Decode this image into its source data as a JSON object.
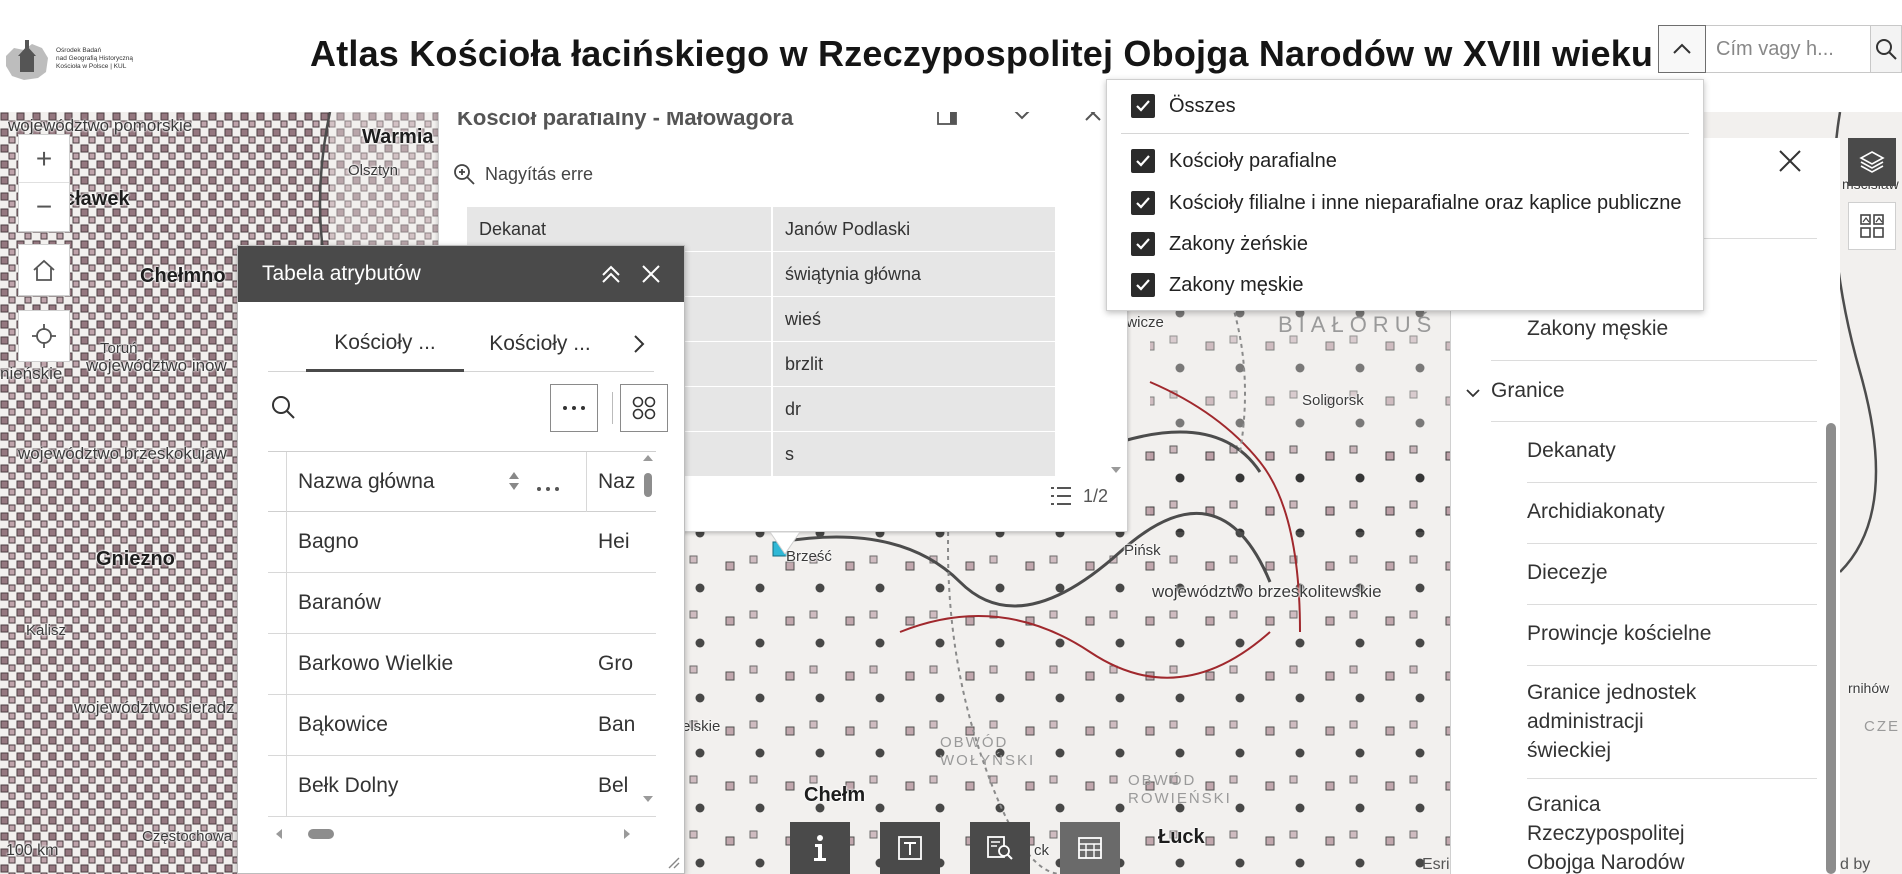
{
  "header": {
    "title": "Atlas Kościoła łacińskiego w Rzeczypospolitej Obojga Narodów w XVIII wieku",
    "logo_text": [
      "Ośrodek Badań",
      "nad Geografią Historyczną",
      "Kościoła w Polsce  |  KUL"
    ],
    "search_placeholder": "Cím vagy h..."
  },
  "map_labels": {
    "woj_pomorskie": "województwo pomorskie",
    "warmia": "Warmia",
    "olsztyn": "Olsztyn",
    "wloclawek": "cławek",
    "chelmno": "Chełmno",
    "torun": "Toruń",
    "woj_inow": "województwo inow",
    "nienskie": "nieńskie",
    "woj_brzesko": "województwo brzeskokujaw",
    "gniezno": "Gniezno",
    "kalisz": "Kalisz",
    "woj_sieradz": "województwo sieradz",
    "czestochowa": "Częstochowa",
    "scale": "100 km",
    "brzesc": "Brześć",
    "pinsk": "Pińsk",
    "woj_brzeskolit": "województwo brzeskolitewskie",
    "soligorsk": "Soligorsk",
    "bialorus": "BIAŁORUŚ",
    "owicze": "owicze",
    "obwod_wolynski": "OBWÓD WOŁYŃSKI",
    "obwod_rowienski": "OBWÓD ROWIEŃSKI",
    "chelm": "Chełm",
    "luck": "Łuck",
    "elskie": "elskie",
    "ck": "ck",
    "ruchiw": "rnihów",
    "cze": "CZE",
    "misclaw": "mscisław",
    "esri_left": "Esri",
    "esri_right": "d by Esri"
  },
  "popup": {
    "title": "Kościół parafialny - Małowagóra",
    "zoom_label": "Nagyítás erre",
    "rows": [
      {
        "key": "Dekanat",
        "value": "Janów Podlaski"
      },
      {
        "key": "",
        "value": "świątynia główna"
      },
      {
        "key": "",
        "value": "wieś"
      },
      {
        "key": "",
        "value": "brzlit"
      },
      {
        "key": "",
        "value": "dr"
      },
      {
        "key": "",
        "value": "s"
      }
    ],
    "pager": "1/2"
  },
  "attribute_table": {
    "title": "Tabela atrybutów",
    "tabs": [
      "Kościoły ...",
      "Kościoły ..."
    ],
    "columns": [
      "Nazwa główna",
      "Naz"
    ],
    "rows": [
      {
        "name": "Bagno",
        "alt": "Hei"
      },
      {
        "name": "Baranów",
        "alt": ""
      },
      {
        "name": "Barkowo Wielkie",
        "alt": "Gro"
      },
      {
        "name": "Bąkowice",
        "alt": "Ban"
      },
      {
        "name": "Bełk Dolny",
        "alt": "Bel"
      }
    ]
  },
  "layer_list": {
    "items": [
      "Zakony męskie",
      "Granice",
      "Dekanaty",
      "Archidiakonaty",
      "Diecezje",
      "Prowincje kościelne",
      "Granice jednostek administracji świeckiej",
      "Granica Rzeczypospolitej Obojga Narodów"
    ]
  },
  "layer_filter": {
    "all": "Összes",
    "options": [
      "Kościoły parafialne",
      "Kościoły filialne i inne nieparafialne oraz kaplice publiczne",
      "Zakony żeńskie",
      "Zakony męskie"
    ]
  },
  "colors": {
    "accent_dark": "#4a4a4a",
    "border_red": "#a0282d",
    "church_marker": "#7a4a56",
    "selected": "#2fb8d6"
  }
}
